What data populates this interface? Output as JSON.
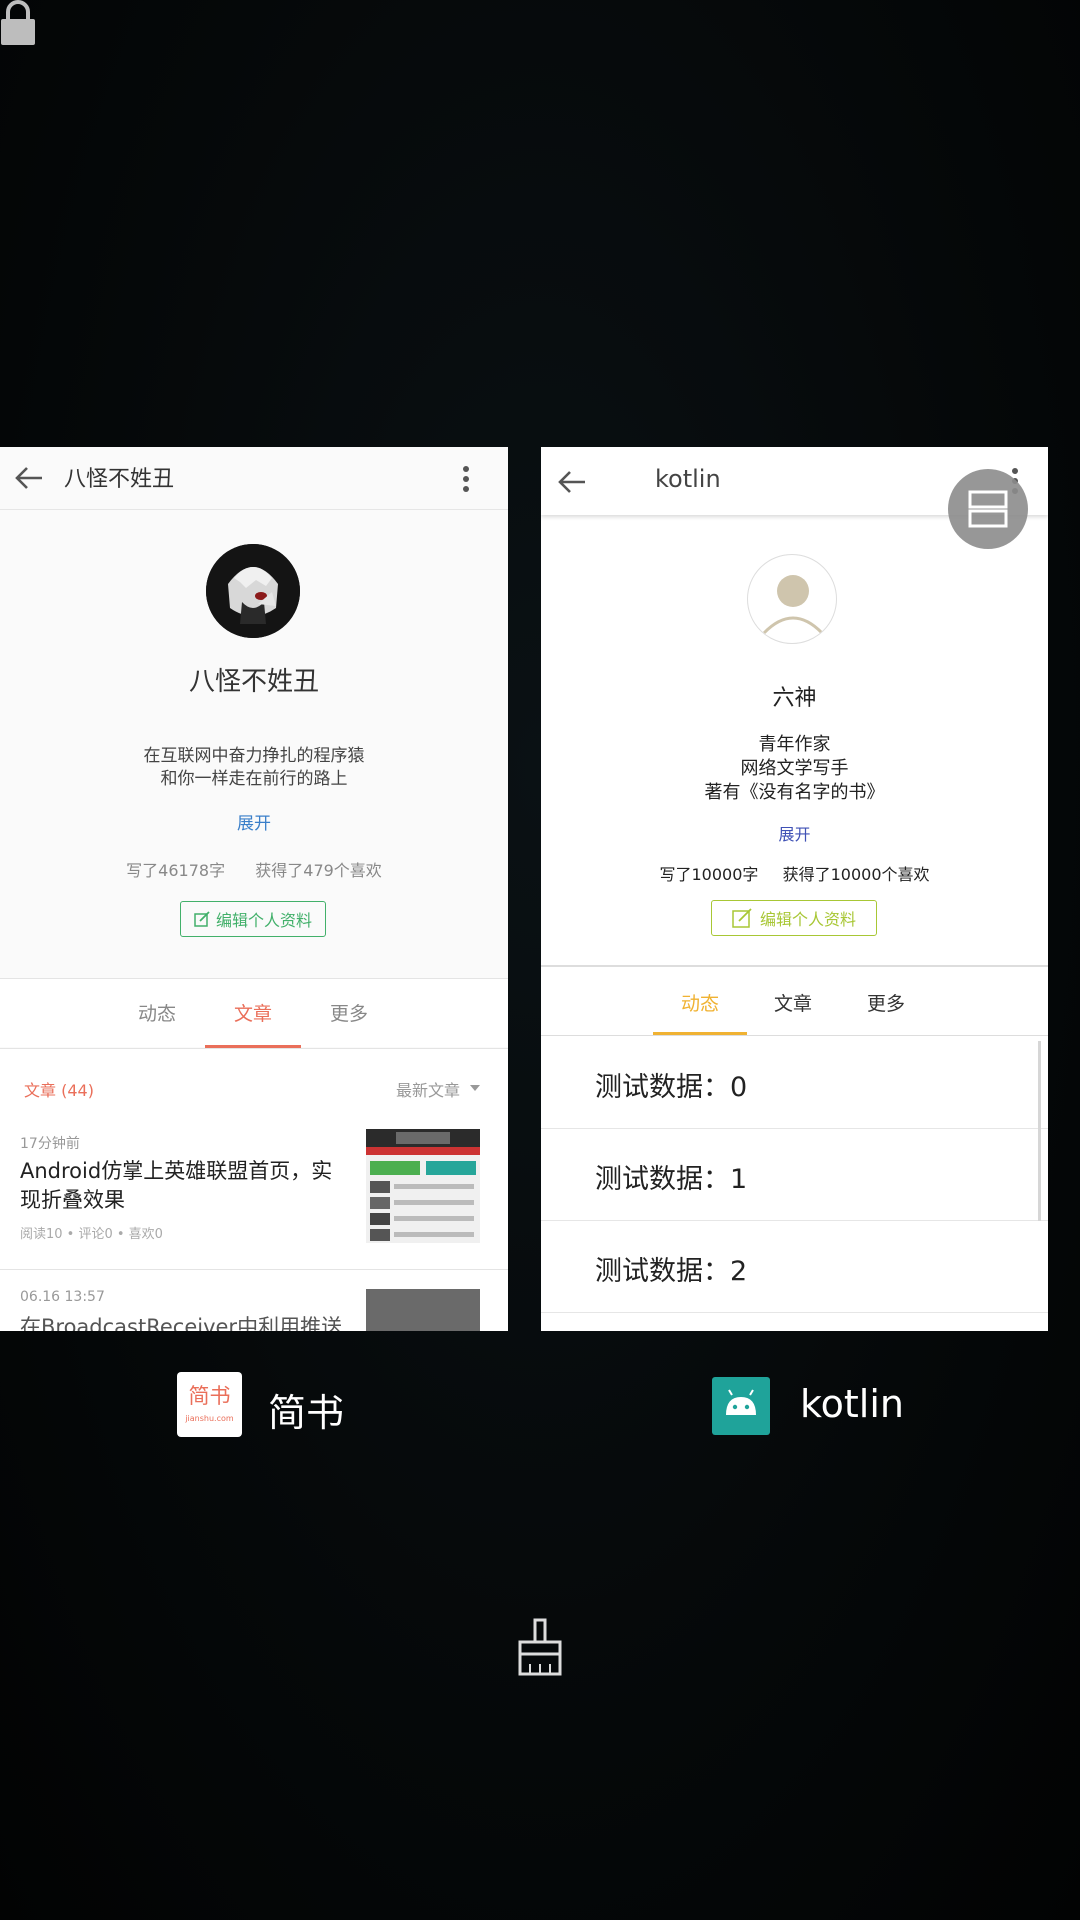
{
  "left_app": {
    "name": "简书",
    "icon_text": "简书",
    "icon_subtext": "jianshu.com",
    "toolbar_title": "八怪不姓丑",
    "profile_name": "八怪不姓丑",
    "bio_lines": [
      "在互联网中奋力挣扎的程序猿",
      "和你一样走在前行的路上"
    ],
    "expand": "展开",
    "stats_words": "写了46178字",
    "stats_likes": "获得了479个喜欢",
    "edit_button": "编辑个人资料",
    "tabs": [
      "动态",
      "文章",
      "更多"
    ],
    "active_tab": "文章",
    "section_label": "文章 (44)",
    "sort_label": "最新文章",
    "articles": [
      {
        "time": "17分钟前",
        "title": "Android仿掌上英雄联盟首页，实现折叠效果",
        "meta": "阅读10 • 评论0 • 喜欢0"
      },
      {
        "time": "06.16 13:57",
        "title": "在BroadcastReceiver中利用推送",
        "meta": ""
      }
    ]
  },
  "right_app": {
    "name": "kotlin",
    "toolbar_title": "kotlin",
    "profile_name": "六神",
    "bio_lines": [
      "青年作家",
      "网络文学写手",
      "著有《没有名字的书》"
    ],
    "expand": "展开",
    "stats_words": "写了10000字",
    "stats_likes": "获得了10000个喜欢",
    "edit_button": "编辑个人资料",
    "tabs": [
      "动态",
      "文章",
      "更多"
    ],
    "active_tab": "动态",
    "rows": [
      "测试数据：0",
      "测试数据：1",
      "测试数据：2"
    ]
  },
  "colors": {
    "jianshu_accent": "#ea6f5a",
    "jianshu_green": "#42b06a",
    "kotlin_tab_accent": "#f0b232",
    "kotlin_edit": "#a8c735",
    "kotlin_icon_bg": "#1fa39a"
  },
  "icons": [
    "lock-icon",
    "back-arrow-icon",
    "more-vert-icon",
    "split-screen-icon",
    "android-icon",
    "clean-brush-icon",
    "edit-icon"
  ]
}
